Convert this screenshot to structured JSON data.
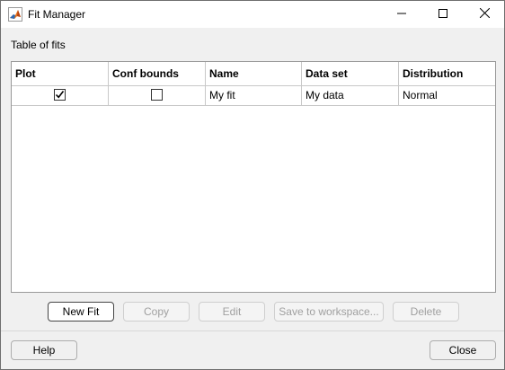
{
  "window": {
    "title": "Fit Manager",
    "controls": {
      "minimize_icon": "minimize-icon",
      "maximize_icon": "maximize-icon",
      "close_icon": "close-icon"
    }
  },
  "main": {
    "section_label": "Table of fits",
    "table": {
      "columns": [
        "Plot",
        "Conf bounds",
        "Name",
        "Data set",
        "Distribution"
      ],
      "rows": [
        {
          "plot": true,
          "conf_bounds": false,
          "name": "My fit",
          "data_set": "My data",
          "distribution": "Normal"
        }
      ]
    }
  },
  "actions": {
    "new_fit": "New Fit",
    "copy": "Copy",
    "edit": "Edit",
    "save_to_workspace": "Save to workspace...",
    "delete": "Delete"
  },
  "footer": {
    "help": "Help",
    "close": "Close"
  },
  "colors": {
    "background": "#f0f0f0",
    "disabled_text": "#a0a0a0",
    "titlebar": "#ffffff"
  }
}
